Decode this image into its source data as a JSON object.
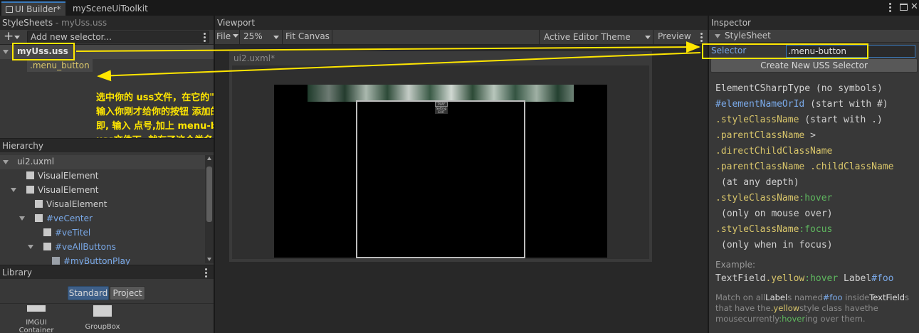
{
  "tabs": [
    {
      "label": "UI Builder*",
      "active": true
    },
    {
      "label": "mySceneUiToolkit",
      "active": false
    }
  ],
  "stylesheets": {
    "title": "StyleSheets",
    "subtitle": "- myUss.uss",
    "selector_placeholder": "Add new selector...",
    "file": "myUss.uss",
    "class_item": ".menu_button"
  },
  "annotation": {
    "lines": [
      "选中你的 uss文件，在它的\"选择器\"框中,",
      "输入你刚才给你的按钮 添加的类名,",
      "即, 输入 点号,加上 menu-button, 回车,",
      "uss文件下, 就有了这个类名"
    ]
  },
  "hierarchy": {
    "title": "Hierarchy",
    "root": "ui2.uxml",
    "items": [
      {
        "label": "VisualElement",
        "style": "plain"
      },
      {
        "label": "VisualElement",
        "style": "plain"
      },
      {
        "label": "VisualElement",
        "style": "plain"
      },
      {
        "label": "#veCenter",
        "style": "id"
      },
      {
        "label": "#veTitel",
        "style": "id"
      },
      {
        "label": "#veAllButtons",
        "style": "id"
      },
      {
        "label": "#myButtonPlay",
        "style": "id"
      }
    ]
  },
  "library": {
    "title": "Library",
    "tab_standard": "Standard",
    "tab_project": "Project",
    "items": [
      "IMGUI Container",
      "GroupBox"
    ]
  },
  "viewport": {
    "title": "Viewport",
    "file_menu": "File",
    "zoom": "25%",
    "fit_canvas": "Fit Canvas",
    "theme": "Active Editor Theme",
    "preview": "Preview",
    "doc_title": "ui2.uxml*",
    "canvas_text": [
      "PLAY",
      "Setting",
      "EXIT"
    ]
  },
  "inspector": {
    "title": "Inspector",
    "section": "StyleSheet",
    "selector_label": "Selector",
    "selector_value": ".menu-button",
    "create_button": "Create New USS Selector",
    "help": {
      "line1_type": "ElementCSharpType",
      "line1_note": "(no symbols)",
      "line2_id": "#elementNameOrId",
      "line2_note": "(start with #)",
      "line3_cls": ".styleClassName",
      "line3_note": "(start with .)",
      "line4": ".parentClassName",
      "line4_op": ">",
      "line5": ".directChildClassName",
      "line6_a": ".parentClassName",
      "line6_b": ".childClassName",
      "line7": "(at any depth)",
      "line8_cls": ".styleClassName",
      "line8_pseudo": ":hover",
      "line9": "(only on mouse over)",
      "line10_cls": ".styleClassName",
      "line10_pseudo": ":focus",
      "line11": "(only when in focus)"
    },
    "example_label": "Example:",
    "example": {
      "a": "TextField",
      "b": ".yellow",
      "c": ":hover",
      "d": "Label",
      "e": "#foo"
    },
    "desc": {
      "p1": "Match on all",
      "p2": "Label",
      "p3": "s named",
      "p4": "#foo",
      "p5": "inside",
      "p6": "TextField",
      "p7": "s",
      "p8": "that have the",
      "p9": ".yellow",
      "p10": "style class",
      "p11": "have",
      "p12": "the",
      "p13": "mouse",
      "p14": "currently",
      "p15": ":hover",
      "p16": "ing",
      "p17": "over them."
    }
  },
  "colors": {
    "accent": "#3a79bb",
    "annotation": "#ffe600",
    "id_blue": "#7aa9e8",
    "class_yellow": "#d8c56a",
    "pseudo_green": "#5fb85f"
  }
}
